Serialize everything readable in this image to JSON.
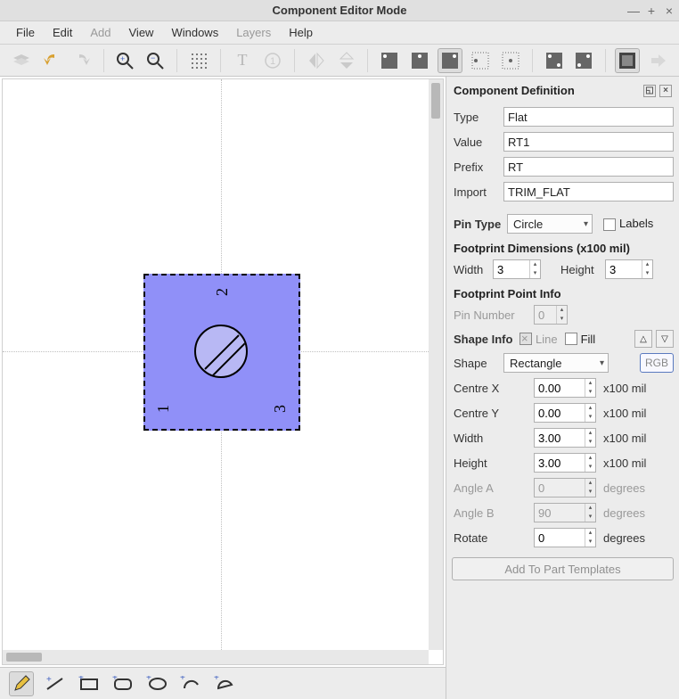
{
  "title": "Component Editor Mode",
  "menu": [
    "File",
    "Edit",
    "Add",
    "View",
    "Windows",
    "Layers",
    "Help"
  ],
  "menu_disabled": [
    2,
    5
  ],
  "panel": {
    "title": "Component Definition",
    "type_label": "Type",
    "type_value": "Flat",
    "value_label": "Value",
    "value_value": "RT1",
    "prefix_label": "Prefix",
    "prefix_value": "RT",
    "import_label": "Import",
    "import_value": "TRIM_FLAT",
    "pintype_label": "Pin Type",
    "pintype_value": "Circle",
    "labels_chk": "Labels",
    "dims_title": "Footprint Dimensions (x100 mil)",
    "width_label": "Width",
    "width_value": "3",
    "height_label": "Height",
    "height_value": "3",
    "pointinfo_title": "Footprint Point Info",
    "pinnum_label": "Pin Number",
    "pinnum_value": "0",
    "shapeinfo_label": "Shape Info",
    "line_label": "Line",
    "fill_label": "Fill",
    "shape_label": "Shape",
    "shape_value": "Rectangle",
    "rgb_label": "RGB",
    "centrex_label": "Centre X",
    "centrex_value": "0.00",
    "centrey_label": "Centre Y",
    "centrey_value": "0.00",
    "swidth_label": "Width",
    "swidth_value": "3.00",
    "sheight_label": "Height",
    "sheight_value": "3.00",
    "anglea_label": "Angle A",
    "anglea_value": "0",
    "angleb_label": "Angle B",
    "angleb_value": "90",
    "rotate_label": "Rotate",
    "rotate_value": "0",
    "unit_mil": "x100 mil",
    "unit_deg": "degrees",
    "addbtn": "Add To Part Templates"
  },
  "canvas": {
    "pins": [
      "1",
      "2",
      "3"
    ]
  }
}
